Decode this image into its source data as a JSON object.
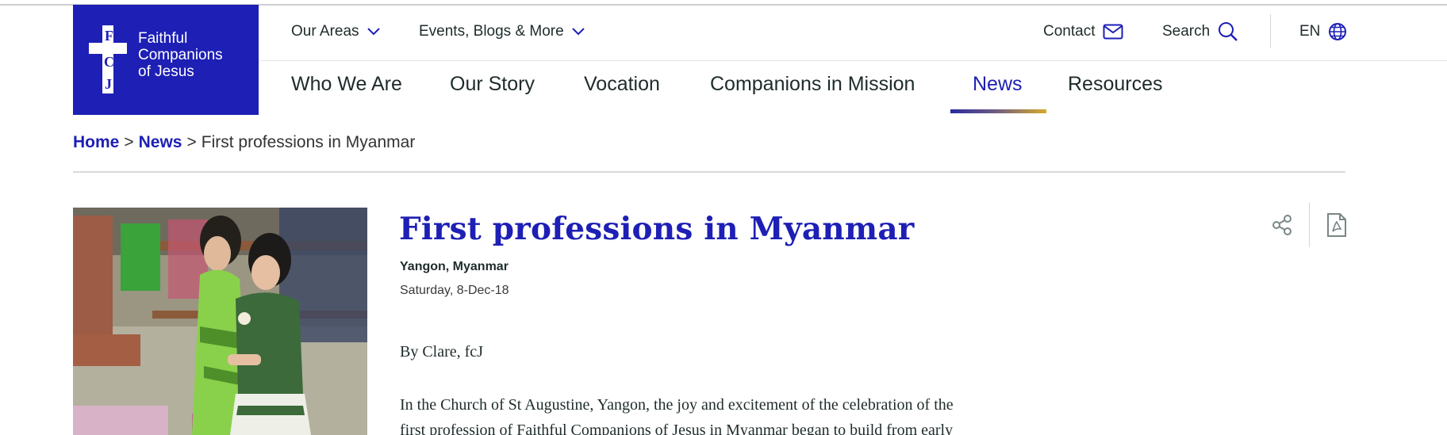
{
  "logo": {
    "line1": "Faithful",
    "line2": "Companions",
    "line3": "of Jesus"
  },
  "utility_nav": {
    "areas_label": "Our Areas",
    "events_label": "Events, Blogs & More",
    "contact_label": "Contact",
    "search_label": "Search",
    "language_label": "EN"
  },
  "main_nav": {
    "items": [
      {
        "label": "Who We Are"
      },
      {
        "label": "Our Story"
      },
      {
        "label": "Vocation"
      },
      {
        "label": "Companions in Mission"
      },
      {
        "label": "News",
        "active": true
      },
      {
        "label": "Resources"
      }
    ]
  },
  "breadcrumb": {
    "home": "Home",
    "separator": ">",
    "news": "News",
    "current": "First professions in Myanmar"
  },
  "article": {
    "title": "First professions in Myanmar",
    "location": "Yangon, Myanmar",
    "date": "Saturday, 8-Dec-18",
    "byline": "By Clare, fcJ",
    "body_line1": "In the Church of St Augustine, Yangon, the joy and excitement of the celebration of the",
    "body_line2": "first profession of Faithful Companions of Jesus in Myanmar began to build from early"
  },
  "colors": {
    "brand_blue": "#1d1fb5",
    "text_dark": "#1f2b2b",
    "active_gradient_start": "#2a2a9e",
    "active_gradient_end": "#d7aa2a"
  },
  "icons": {
    "logo": "cross-fcj-logo",
    "dropdown": "chevron-down-icon",
    "contact": "envelope-icon",
    "search": "search-icon",
    "language": "globe-icon",
    "share": "share-icon",
    "pdf": "pdf-icon"
  }
}
